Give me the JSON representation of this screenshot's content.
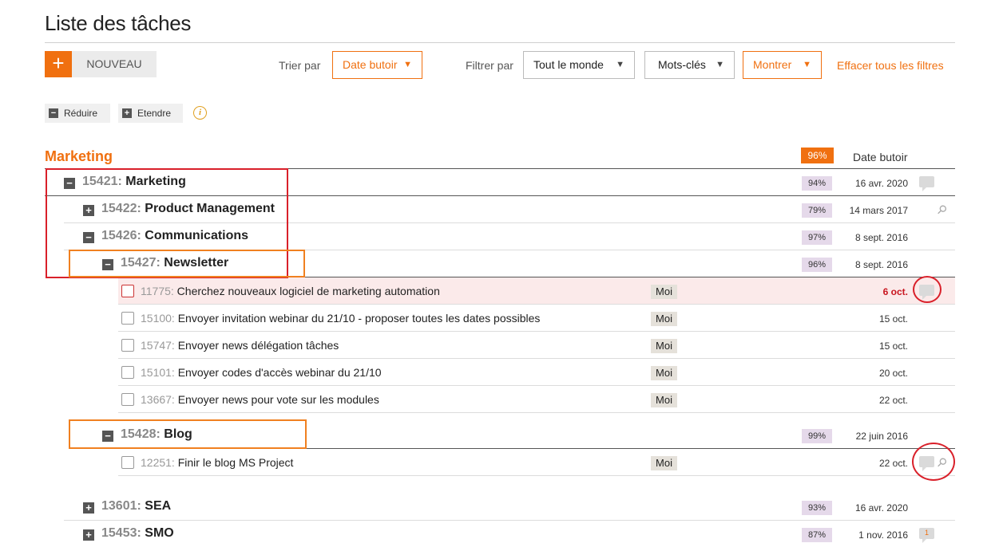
{
  "page": {
    "title": "Liste des tâches"
  },
  "toolbar": {
    "add_icon": "+",
    "new_label": "NOUVEAU",
    "sort_label": "Trier par",
    "sort_value": "Date butoir",
    "filter_label": "Filtrer par",
    "filter_people": "Tout le monde",
    "filter_keywords": "Mots-clés",
    "show_label": "Montrer",
    "clear_filters": "Effacer tous les filtres",
    "caret": "▼"
  },
  "tree_controls": {
    "collapse_label": "Réduire",
    "expand_label": "Etendre",
    "info_icon": "i"
  },
  "project": {
    "name": "Marketing",
    "percent": "96%",
    "column_due": "Date butoir"
  },
  "rows": [
    {
      "kind": "group",
      "toggle": "−",
      "num": "15421:",
      "name": "Marketing",
      "percent": "94%",
      "date": "16 avr. 2020"
    },
    {
      "kind": "group",
      "toggle": "+",
      "num": "15422:",
      "name": "Product Management",
      "percent": "79%",
      "date": "14 mars 2017"
    },
    {
      "kind": "group",
      "toggle": "−",
      "num": "15426:",
      "name": "Communications",
      "percent": "97%",
      "date": "8 sept. 2016"
    },
    {
      "kind": "group",
      "toggle": "−",
      "num": "15427:",
      "name": "Newsletter",
      "percent": "96%",
      "date": "8 sept. 2016"
    },
    {
      "kind": "task",
      "num": "11775:",
      "name": "Cherchez nouveaux logiciel de marketing automation",
      "assignee": "Moi",
      "date": "6 oct."
    },
    {
      "kind": "task",
      "num": "15100:",
      "name": "Envoyer invitation webinar du 21/10 - proposer toutes les dates possibles",
      "assignee": "Moi",
      "date": "15 oct."
    },
    {
      "kind": "task",
      "num": "15747:",
      "name": "Envoyer news délégation tâches",
      "assignee": "Moi",
      "date": "15 oct."
    },
    {
      "kind": "task",
      "num": "15101:",
      "name": "Envoyer codes d'accès webinar du 21/10",
      "assignee": "Moi",
      "date": "20 oct."
    },
    {
      "kind": "task",
      "num": "13667:",
      "name": "Envoyer news pour vote sur les modules",
      "assignee": "Moi",
      "date": "22 oct."
    },
    {
      "kind": "group",
      "toggle": "−",
      "num": "15428:",
      "name": "Blog",
      "percent": "99%",
      "date": "22 juin 2016"
    },
    {
      "kind": "task",
      "num": "12251:",
      "name": "Finir le blog MS Project",
      "assignee": "Moi",
      "date": "22 oct."
    },
    {
      "kind": "group",
      "toggle": "+",
      "num": "13601:",
      "name": "SEA",
      "percent": "93%",
      "date": "16 avr. 2020"
    },
    {
      "kind": "group",
      "toggle": "+",
      "num": "15453:",
      "name": "SMO",
      "percent": "87%",
      "date": "1 nov. 2016",
      "comment_count": "1"
    }
  ],
  "icons": {
    "comment": "comment-icon",
    "attachment": "paperclip-icon",
    "attachment_glyph": "⚲"
  },
  "colors": {
    "accent": "#f07010",
    "overdue": "#c8141e",
    "annotation_red": "#d9202a",
    "annotation_orange": "#f08020",
    "percent_badge": "#e5d9ea"
  }
}
